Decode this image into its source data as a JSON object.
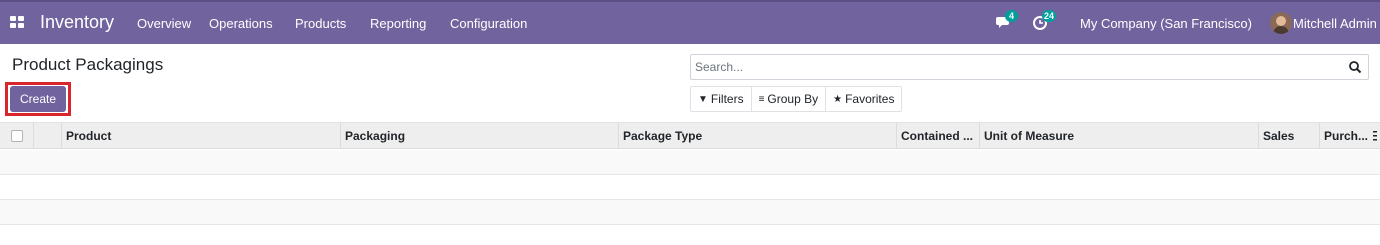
{
  "navbar": {
    "brand": "Inventory",
    "menus": [
      "Overview",
      "Operations",
      "Products",
      "Reporting",
      "Configuration"
    ],
    "messages_icon": "chat-bubbles-icon",
    "messages_count": "4",
    "activities_icon": "clock-activity-icon",
    "activities_count": "24",
    "company": "My Company (San Francisco)",
    "user": "Mitchell Admin",
    "color": "#71639e"
  },
  "control_panel": {
    "title": "Product Packagings",
    "create_label": "Create",
    "search_placeholder": "Search...",
    "filters_label": "Filters",
    "group_by_label": "Group By",
    "favorites_label": "Favorites"
  },
  "table": {
    "columns": [
      "Product",
      "Packaging",
      "Package Type",
      "Contained ...",
      "Unit of Measure",
      "Sales",
      "Purch..."
    ],
    "rows": []
  },
  "colors": {
    "accent": "#71639e",
    "highlight": "#d9262c",
    "badge": "#00a09d"
  }
}
